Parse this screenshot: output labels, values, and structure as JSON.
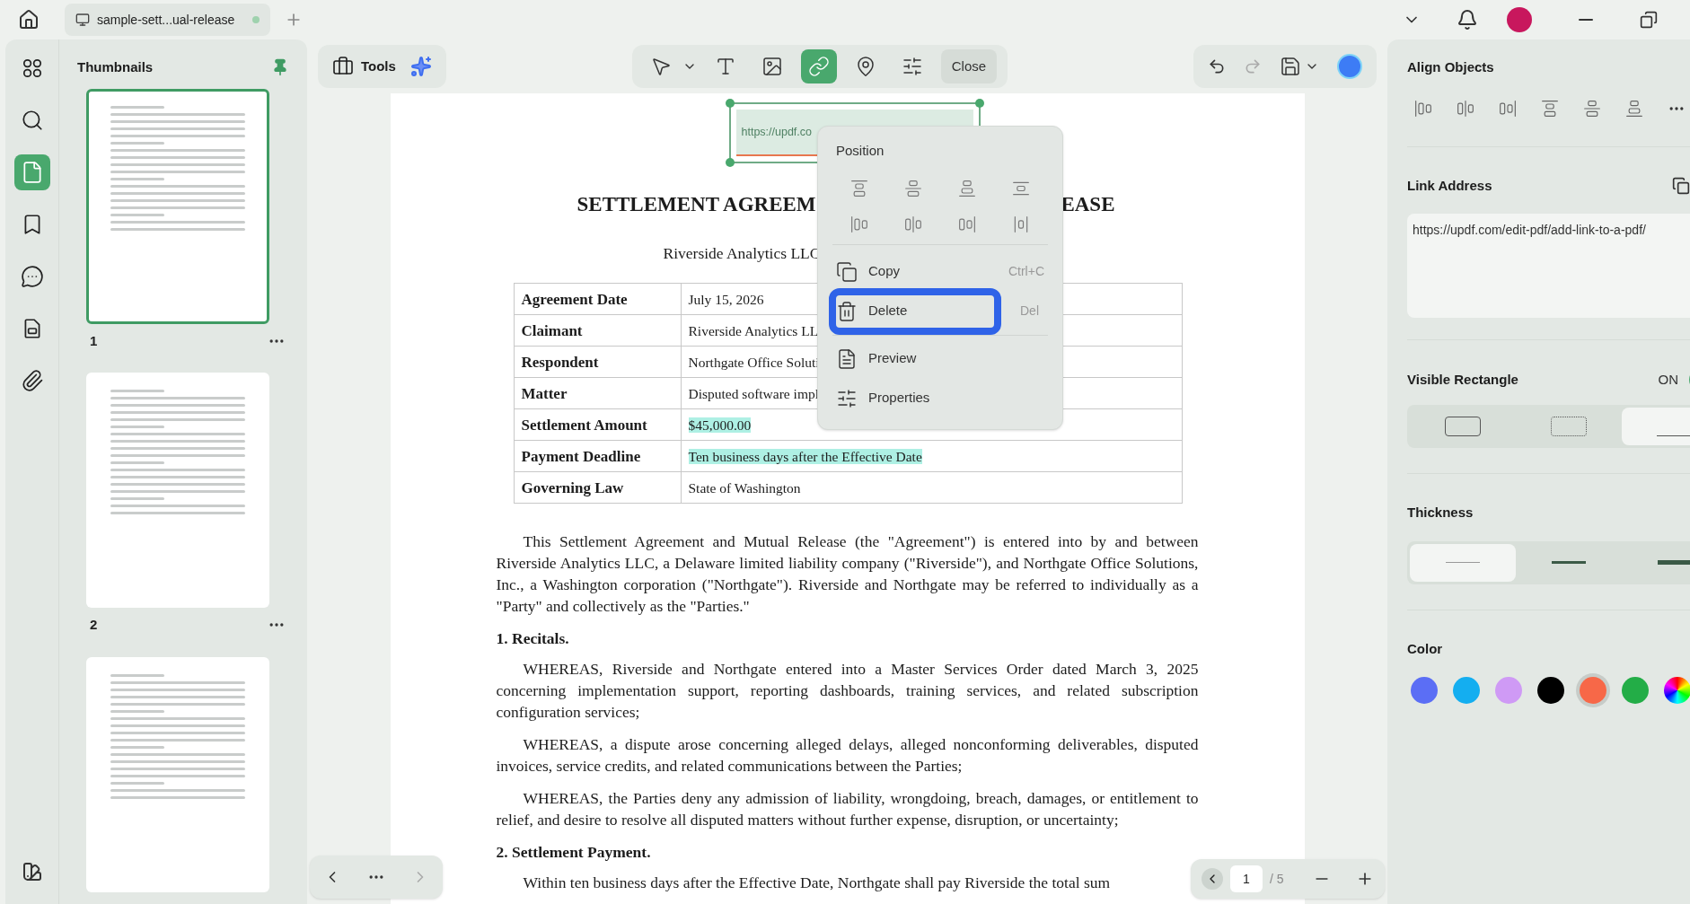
{
  "tab": {
    "title": "sample-sett...ual-release"
  },
  "rail": [
    {
      "kind": "grid",
      "selected": false
    },
    {
      "kind": "search",
      "selected": false
    },
    {
      "kind": "page",
      "selected": true
    },
    {
      "kind": "bookmark",
      "selected": false
    },
    {
      "kind": "comment",
      "selected": false
    },
    {
      "kind": "form",
      "selected": false
    },
    {
      "kind": "attach",
      "selected": false
    }
  ],
  "sidebar": {
    "title": "Thumbnails"
  },
  "thumbnails": [
    {
      "page": "1",
      "selected": true
    },
    {
      "page": "2",
      "selected": false
    },
    {
      "selected": false
    }
  ],
  "toolbar": {
    "tools_label": "Tools",
    "tools": [
      {
        "kind": "select",
        "selected": false
      },
      {
        "kind": "text",
        "selected": false
      },
      {
        "kind": "image",
        "selected": false
      },
      {
        "kind": "link",
        "selected": true
      },
      {
        "kind": "pin",
        "selected": false
      },
      {
        "kind": "settings",
        "selected": false
      }
    ],
    "close": "Close",
    "redo_disabled": true
  },
  "document": {
    "link_text": "https://updf.co",
    "title_left": "SETTLEMENT AGREEM",
    "title_right": "EASE",
    "subtitle": "Riverside Analytics LLC",
    "rows": [
      {
        "label": "Agreement Date",
        "value": "July 15, 2026",
        "highlighted": false
      },
      {
        "label": "Claimant",
        "value": "Riverside Analytics LL",
        "highlighted": false
      },
      {
        "label": "Respondent",
        "value": "Northgate Office Soluti",
        "highlighted": false
      },
      {
        "label": "Matter",
        "value": "Disputed software impl",
        "highlighted": false
      },
      {
        "label": "Settlement Amount",
        "value": "$45,000.00",
        "highlighted": true
      },
      {
        "label": "Payment Deadline",
        "value": "Ten business days after the Effective Date",
        "highlighted": true
      },
      {
        "label": "Governing Law",
        "value": "State of Washington",
        "highlighted": false
      }
    ],
    "blocks": [
      {
        "kind": "para",
        "text": "This Settlement Agreement and Mutual Release (the \"Agreement\") is entered into by and between Riverside Analytics LLC, a Delaware limited liability company (\"Riverside\"), and Northgate Office Solutions, Inc., a Washington corporation (\"Northgate\"). Riverside and Northgate may be referred to individually as a \"Party\" and collectively as the \"Parties.\""
      },
      {
        "kind": "heading",
        "text": "1. Recitals."
      },
      {
        "kind": "para",
        "text": "WHEREAS, Riverside and Northgate entered into a Master Services Order dated March 3, 2025 concerning implementation support, reporting dashboards, training services, and related subscription configuration services;"
      },
      {
        "kind": "para",
        "text": "WHEREAS, a dispute arose concerning alleged delays, alleged nonconforming deliverables, disputed invoices, service credits, and related communications between the Parties;"
      },
      {
        "kind": "para",
        "text": "WHEREAS, the Parties deny any admission of liability, wrongdoing, breach, damages, or entitlement to relief, and desire to resolve all disputed matters without further expense, disruption, or uncertainty;"
      },
      {
        "kind": "heading",
        "text": "2. Settlement Payment."
      },
      {
        "kind": "para",
        "text": "Within ten business days after the Effective Date, Northgate shall pay Riverside the total sum"
      }
    ]
  },
  "context_menu": {
    "heading": "Position",
    "items": [
      {
        "kind": "copy",
        "label": "Copy",
        "shortcut": "Ctrl+C",
        "highlighted": false
      },
      {
        "kind": "delete",
        "label": "Delete",
        "shortcut": "Del",
        "highlighted": true
      },
      {
        "kind": "preview",
        "label": "Preview",
        "highlighted": false
      },
      {
        "kind": "properties",
        "label": "Properties",
        "highlighted": false
      }
    ]
  },
  "pager": {
    "page": "1",
    "total": "/ 5"
  },
  "panel": {
    "align_title": "Align Objects",
    "link_title": "Link Address",
    "link_value": "https://updf.com/edit-pdf/add-link-to-a-pdf/",
    "visible_title": "Visible Rectangle",
    "on_label": "ON",
    "on": true,
    "styles": [
      {
        "kind": "solid",
        "selected": false
      },
      {
        "kind": "dashed",
        "selected": false
      },
      {
        "kind": "underline",
        "selected": true
      }
    ],
    "thickness_title": "Thickness",
    "thickness": [
      {
        "kind": "thin",
        "selected": true
      },
      {
        "kind": "medium",
        "selected": false
      },
      {
        "kind": "thick",
        "selected": false
      }
    ],
    "color_title": "Color",
    "colors": [
      {
        "kind": "swatch",
        "color": "#5b6ef5",
        "selected": false
      },
      {
        "kind": "swatch",
        "color": "#14aef0",
        "selected": false
      },
      {
        "kind": "swatch",
        "color": "#cf9af5",
        "selected": false
      },
      {
        "kind": "swatch",
        "color": "#000000",
        "selected": false
      },
      {
        "kind": "swatch",
        "color": "#f76848",
        "selected": true
      },
      {
        "kind": "swatch",
        "color": "#23ad47",
        "selected": false
      },
      {
        "kind": "custom",
        "selected": false
      }
    ]
  }
}
